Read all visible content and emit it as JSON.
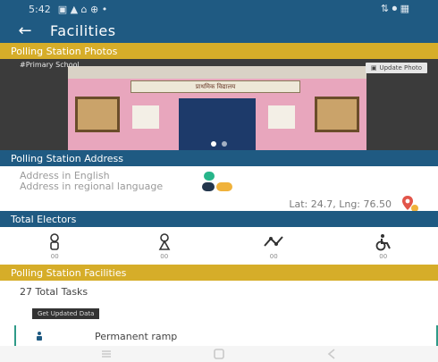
{
  "status_bar": {
    "time": "5:42",
    "right": "⇅ ⏺ ▦"
  },
  "app_bar": {
    "title": "Facilities"
  },
  "sections": {
    "photos": "Polling Station Photos",
    "address": "Polling Station Address",
    "electors": "Total Electors",
    "facilities": "Polling Station Facilities"
  },
  "photo": {
    "label": "#Primary School",
    "update_label": "Update Photo",
    "sign_text": "प्राथमिक विद्यालय"
  },
  "address": {
    "english_label": "Address in English",
    "regional_label": "Address in regional language",
    "latlng": "Lat: 24.7, Lng: 76.50"
  },
  "electors": [
    {
      "icon": "male-icon",
      "value": "00"
    },
    {
      "icon": "female-icon",
      "value": "00"
    },
    {
      "icon": "third-gender-icon",
      "value": "00"
    },
    {
      "icon": "wheelchair-icon",
      "value": "00"
    }
  ],
  "facilities": {
    "count_label": "27 Total Tasks",
    "update_button": "Get Updated Data",
    "first_item": "Permanent ramp"
  },
  "colors": {
    "primary": "#1f5a82",
    "section_yellow": "#d6ad29",
    "accent_green": "#27b58a",
    "accent_orange": "#f0b23b"
  }
}
